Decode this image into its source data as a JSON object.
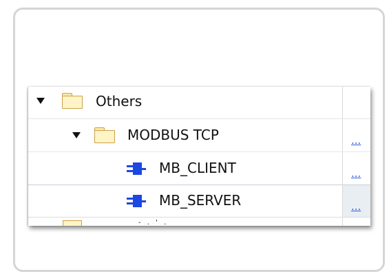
{
  "tree": {
    "items": [
      {
        "label": "Others",
        "type": "folder",
        "expanded": true,
        "icon": "folder-icon"
      },
      {
        "label": "MODBUS TCP",
        "type": "folder",
        "expanded": true,
        "icon": "folder-icon",
        "link_text": "..."
      },
      {
        "label": "MB_CLIENT",
        "type": "function-block",
        "icon": "function-block-icon",
        "link_text": "..."
      },
      {
        "label": "MB_SERVER",
        "type": "function-block",
        "icon": "function-block-icon",
        "link_text": "...",
        "selected": true
      }
    ],
    "partial_row_text": "- . ' ."
  },
  "colors": {
    "folder_fill": "#fff4c6",
    "folder_stroke": "#c9a04a",
    "function_block": "#1c47e0",
    "link": "#2e5bd8",
    "frame_border": "#d5d5d5",
    "selected_row_bg": "#e9eef3"
  }
}
